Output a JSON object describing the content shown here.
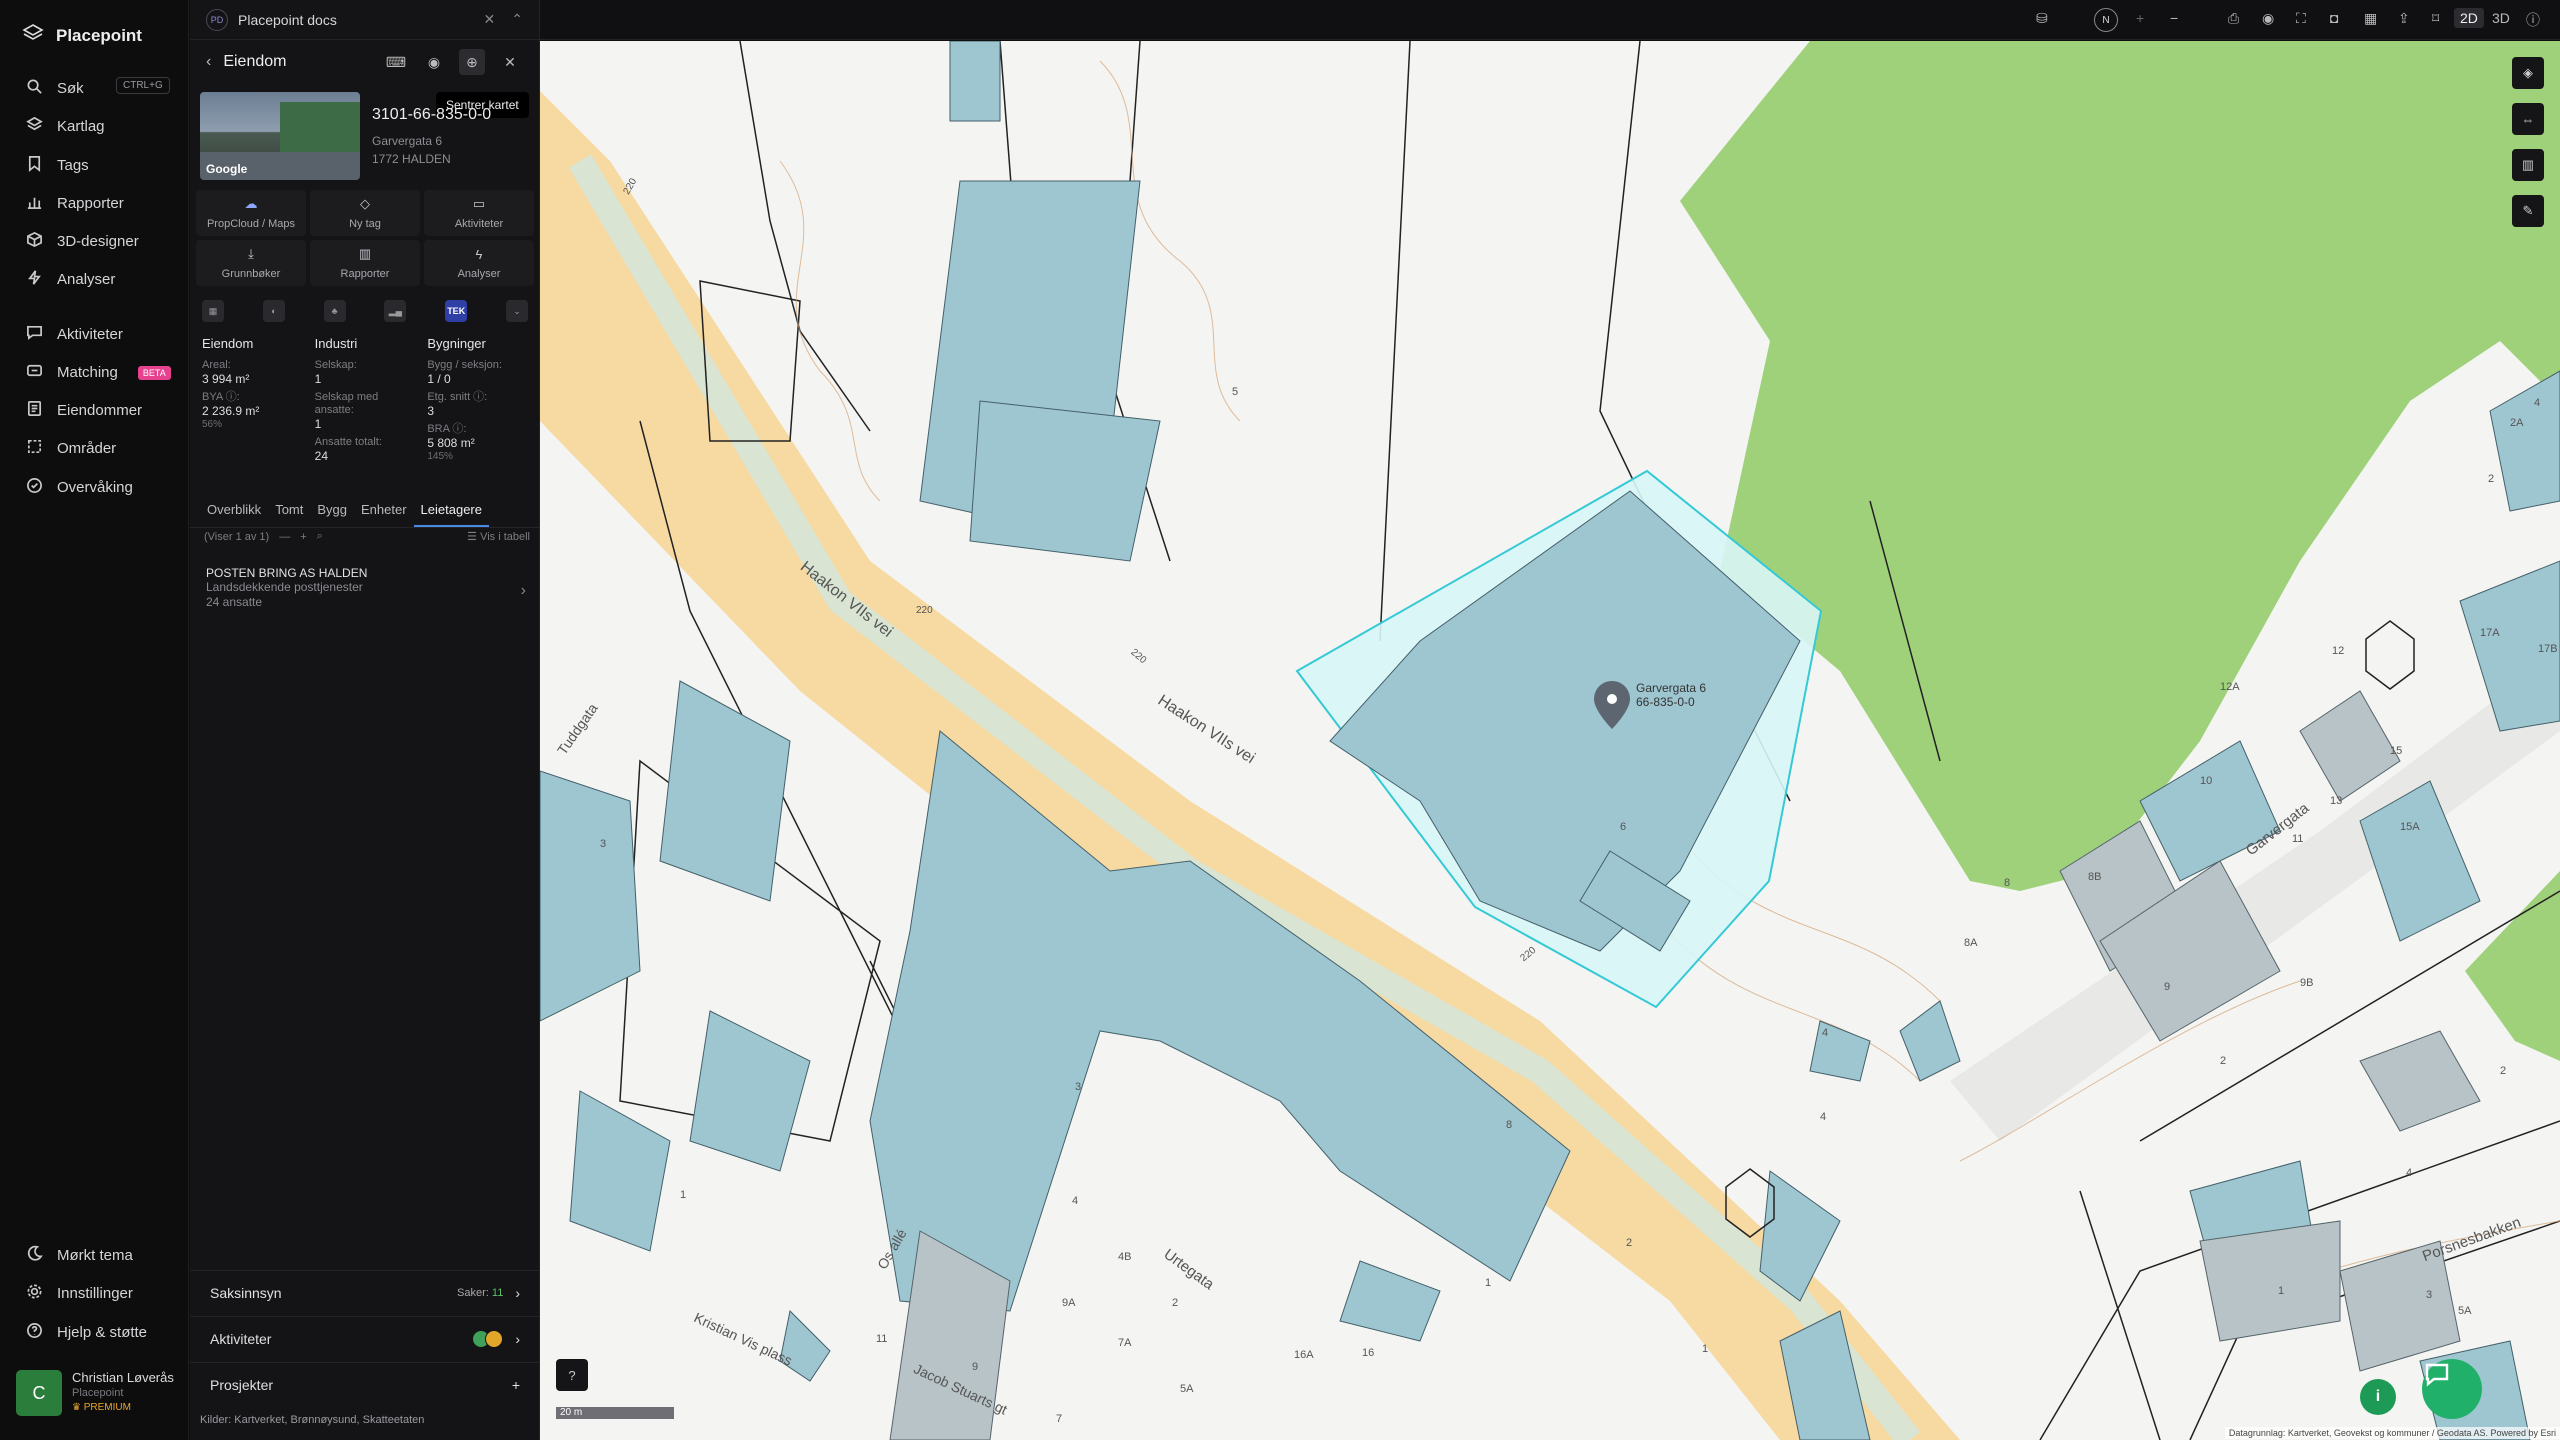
{
  "nav": {
    "brand": "Placepoint",
    "items": [
      {
        "label": "Søk",
        "shortcut": "CTRL+G"
      },
      {
        "label": "Kartlag"
      },
      {
        "label": "Tags"
      },
      {
        "label": "Rapporter"
      },
      {
        "label": "3D-designer"
      },
      {
        "label": "Analyser"
      },
      {
        "label": "Aktiviteter"
      },
      {
        "label": "Matching",
        "badge": "BETA"
      },
      {
        "label": "Eiendommer"
      },
      {
        "label": "Områder"
      },
      {
        "label": "Overvåking"
      }
    ],
    "bottom": [
      {
        "label": "Mørkt tema"
      },
      {
        "label": "Innstillinger"
      },
      {
        "label": "Hjelp & støtte"
      }
    ],
    "user": {
      "initial": "C",
      "name": "Christian Løverås",
      "org": "Placepoint",
      "plan": "PREMIUM"
    }
  },
  "panel": {
    "doc_tab": "Placepoint docs",
    "doc_logo": "PD",
    "header_title": "Eiendom",
    "tooltip": "Sentrer kartet",
    "property": {
      "id": "3101-66-835-0-0",
      "street": "Garvergata 6",
      "city": "1772 HALDEN",
      "thumb_label": "Google"
    },
    "actions": [
      {
        "label": "PropCloud / Maps",
        "icon": "☁"
      },
      {
        "label": "Ny tag",
        "icon": "◇"
      },
      {
        "label": "Aktiviteter",
        "icon": "▭"
      },
      {
        "label": "Grunnbøker",
        "icon": "⤓"
      },
      {
        "label": "Rapporter",
        "icon": "▥"
      },
      {
        "label": "Analyser",
        "icon": "ϟ"
      }
    ],
    "icon_tek": "TEK",
    "stats": {
      "eiendom": {
        "title": "Eiendom",
        "areal_label": "Areal:",
        "areal": "3 994 m²",
        "bya_label": "BYA ⓘ:",
        "bya": "2 236.9 m²",
        "bya_pct": "56%"
      },
      "industri": {
        "title": "Industri",
        "selskap_label": "Selskap:",
        "selskap": "1",
        "ansatte_label": "Selskap med ansatte:",
        "ansatte": "1",
        "ansatte_tot_label": "Ansatte totalt:",
        "ansatte_tot": "24"
      },
      "bygninger": {
        "title": "Bygninger",
        "bygg_label": "Bygg / seksjon:",
        "bygg": "1 / 0",
        "etg_label": "Etg. snitt ⓘ:",
        "etg": "3",
        "bra_label": "BRA ⓘ:",
        "bra": "5 808 m²",
        "bra_pct": "145%"
      }
    },
    "tabs": [
      "Overblikk",
      "Tomt",
      "Bygg",
      "Enheter",
      "Leietagere"
    ],
    "list": {
      "count_text": "(Viser 1 av 1)",
      "table_label": "Vis i tabell",
      "rows": [
        {
          "name": "POSTEN BRING AS HALDEN",
          "desc": "Landsdekkende posttjenester",
          "employees": "24 ansatte"
        }
      ]
    },
    "sections": [
      {
        "label": "Saksinnsyn",
        "meta_label": "Saker:",
        "meta_value": "11"
      },
      {
        "label": "Aktiviteter"
      },
      {
        "label": "Prosjekter"
      }
    ],
    "sources_label": "Kilder:",
    "sources": "Kartverket, Brønnøysund, Skatteetaten"
  },
  "topbar": {
    "north": "N",
    "mode_2d": "2D",
    "mode_3d": "3D"
  },
  "map": {
    "marker_label_1": "Garvergata 6",
    "marker_label_2": "66-835-0-0",
    "street_labels": [
      "Haakon VIIs vei",
      "Haakon VIIs vei",
      "Garvergata",
      "Urtegata",
      "Kristian Vis plass",
      "Os allé",
      "Porsnesbakken",
      "Jacob Stuarts gt",
      "Tuddgata"
    ],
    "road_numbers": [
      "220",
      "220",
      "220",
      "220"
    ],
    "house_numbers": [
      "5",
      "3",
      "6",
      "4",
      "8",
      "3",
      "1",
      "2",
      "1",
      "4",
      "4B",
      "9A",
      "7A",
      "2",
      "5A",
      "16A",
      "16",
      "11",
      "9",
      "7",
      "1",
      "12",
      "12A",
      "10",
      "11",
      "13",
      "15",
      "15A",
      "8B",
      "8",
      "8A",
      "9",
      "9B",
      "2",
      "4",
      "17A",
      "17B",
      "4",
      "2A",
      "2",
      "5A",
      "3",
      "1",
      "4",
      "2"
    ],
    "scale": "20 m",
    "attribution": "Datagrunnlag: Kartverket, Geovekst og kommuner / Geodata AS. Powered by Esri"
  },
  "colors": {
    "accent": "#4a8be8",
    "building": "#9ec6d0",
    "park": "#9fd17b",
    "road": "#f7d9a2",
    "selection": "#35c9d6",
    "chat": "#21b069"
  }
}
